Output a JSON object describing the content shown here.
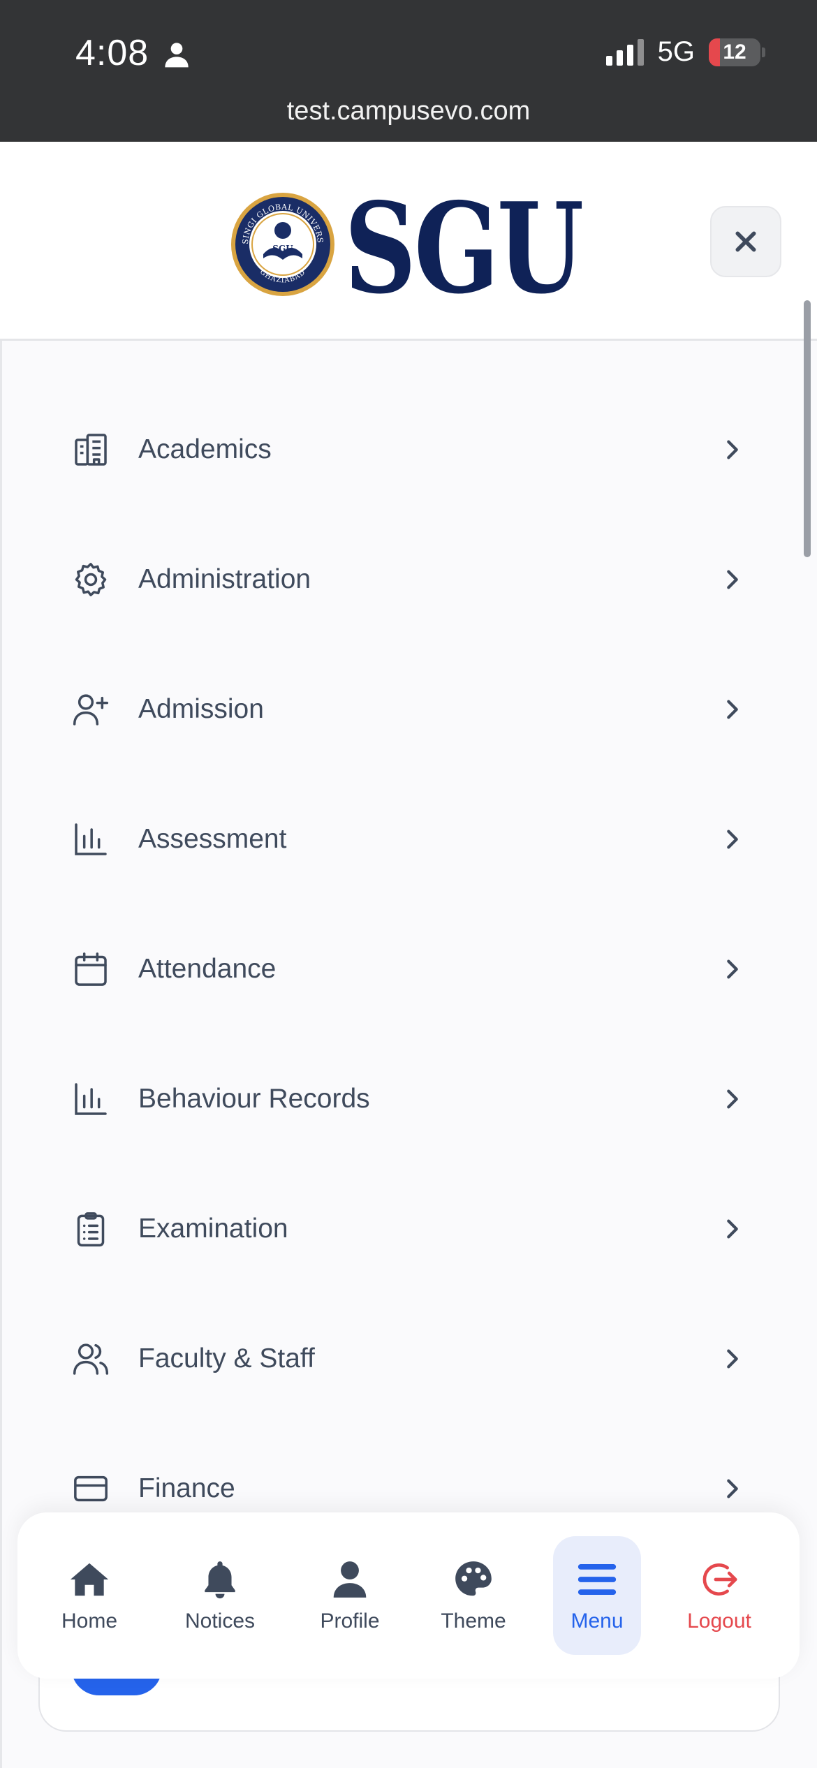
{
  "status_bar": {
    "time": "4:08",
    "network": "5G",
    "battery": "12",
    "url": "test.campusevo.com"
  },
  "header": {
    "logo_text": "SGU",
    "logo_seal_text": "SINGI GLOBAL UNIVERSITY · GHAZIABAD",
    "close_icon": "close-icon"
  },
  "menu": {
    "items": [
      {
        "label": "Academics",
        "icon": "building-icon"
      },
      {
        "label": "Administration",
        "icon": "gear-icon"
      },
      {
        "label": "Admission",
        "icon": "user-plus-icon"
      },
      {
        "label": "Assessment",
        "icon": "bar-chart-icon"
      },
      {
        "label": "Attendance",
        "icon": "calendar-icon"
      },
      {
        "label": "Behaviour Records",
        "icon": "bar-chart-icon"
      },
      {
        "label": "Examination",
        "icon": "clipboard-list-icon"
      },
      {
        "label": "Faculty & Staff",
        "icon": "users-icon"
      },
      {
        "label": "Finance",
        "icon": "credit-card-icon"
      }
    ]
  },
  "bottom_nav": {
    "items": [
      {
        "label": "Home",
        "icon": "home-icon"
      },
      {
        "label": "Notices",
        "icon": "bell-icon"
      },
      {
        "label": "Profile",
        "icon": "user-icon"
      },
      {
        "label": "Theme",
        "icon": "palette-icon"
      },
      {
        "label": "Menu",
        "icon": "menu-icon",
        "active": true
      },
      {
        "label": "Logout",
        "icon": "logout-icon"
      }
    ]
  },
  "colors": {
    "accent": "#2563eb",
    "logout": "#e5484d",
    "text": "#3f4a5c",
    "logo_navy": "#0f2257"
  }
}
